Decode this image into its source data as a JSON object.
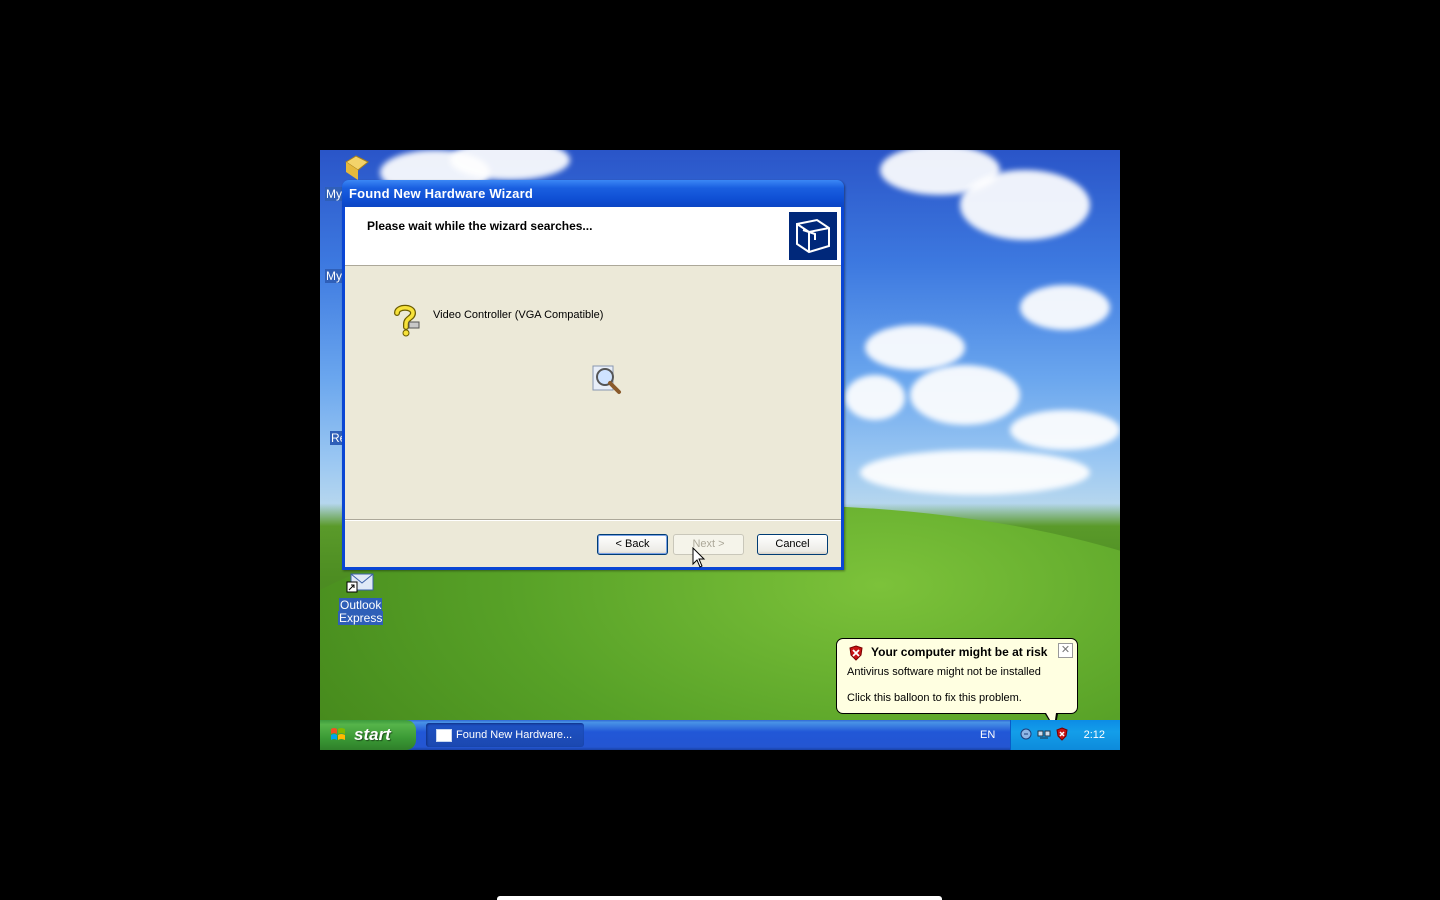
{
  "desktop": {
    "icons": [
      {
        "label": "My",
        "icon": "my-documents-icon"
      },
      {
        "label": "My",
        "icon": "my-computer-icon"
      },
      {
        "label": "Re",
        "icon": "recycle-bin-icon"
      },
      {
        "label_line1": "Outlook",
        "label_line2": "Express",
        "icon": "outlook-express-icon"
      }
    ]
  },
  "wizard": {
    "title": "Found New Hardware Wizard",
    "header": "Please wait while the wizard searches...",
    "header_icon": "hardware-wizard-icon",
    "device_icon": "unknown-device-question-icon",
    "device_name": "Video Controller (VGA Compatible)",
    "search_icon": "searching-magnifier-icon",
    "buttons": {
      "back": "< Back",
      "next": "Next >",
      "cancel": "Cancel"
    }
  },
  "taskbar": {
    "start_label": "start",
    "task_button": "Found New Hardware...",
    "language": "EN",
    "clock": "2:12",
    "tray_icons": [
      "speaker-icon",
      "network-icon",
      "security-shield-icon"
    ]
  },
  "balloon": {
    "title": "Your computer might be at risk",
    "line1": "Antivirus software might not be installed",
    "line2": "Click this balloon to fix this problem.",
    "icon": "security-shield-icon"
  },
  "colors": {
    "titlebar": "#0a46d4",
    "taskbar": "#2456d2",
    "start": "#3b9a35",
    "balloon_bg": "#ffffe1"
  }
}
